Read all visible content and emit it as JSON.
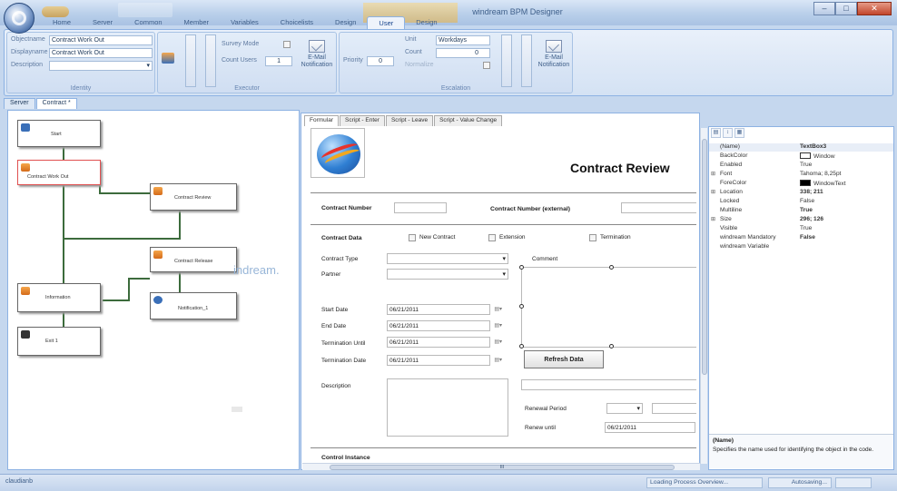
{
  "window": {
    "title": "windream BPM Designer"
  },
  "ribbon_tabs": [
    "Home",
    "Server",
    "Common",
    "Member",
    "Variables",
    "Choicelists",
    "Design",
    "User",
    "Design"
  ],
  "ribbon_active_tab": "User",
  "identity": {
    "objectname_label": "Objectname",
    "objectname_value": "Contract Work Out",
    "displayname_label": "Displayname",
    "displayname_value": "Contract Work Out",
    "description_label": "Description",
    "caption": "Identity"
  },
  "executor": {
    "survey_mode_label": "Survey Mode",
    "count_users_label": "Count Users",
    "count_users_value": "1",
    "email_label_1": "E-Mail",
    "email_label_2": "Notification",
    "caption": "Executor"
  },
  "escalation": {
    "priority_label": "Priority",
    "priority_value": "0",
    "unit_label": "Unit",
    "unit_value": "Workdays",
    "count_label": "Count",
    "count_value": "0",
    "normalize_label": "Normalize",
    "email_label_1": "E-Mail",
    "email_label_2": "Notification",
    "caption": "Escalation"
  },
  "doc_tabs": [
    "Server",
    "Contract *"
  ],
  "workflow": {
    "nodes": [
      "Start",
      "Contract Work Out",
      "Contract Review",
      "Contract Release",
      "Information",
      "Notification_1",
      "Exit 1"
    ],
    "watermark": "indream."
  },
  "form_tabs": [
    "Formular",
    "Script - Enter",
    "Script - Leave",
    "Script - Value Change"
  ],
  "form": {
    "title": "Contract Review",
    "contract_number_label": "Contract Number",
    "contract_number_ext_label": "Contract Number (external)",
    "contract_data_label": "Contract Data",
    "new_contract_label": "New Contract",
    "extension_label": "Extension",
    "termination_label": "Termination",
    "contract_type_label": "Contract Type",
    "partner_label": "Partner",
    "comment_label": "Comment",
    "start_date_label": "Start Date",
    "start_date_value": "06/21/2011",
    "end_date_label": "End Date",
    "end_date_value": "06/21/2011",
    "termination_until_label": "Termination Until",
    "termination_until_value": "06/21/2011",
    "termination_date_label": "Termination Date",
    "termination_date_value": "06/21/2011",
    "refresh_label": "Refresh Data",
    "description_label": "Description",
    "renewal_period_label": "Renewal Period",
    "renew_until_label": "Renew until",
    "renew_until_value": "06/21/2011",
    "bottom_label": "Control Instance"
  },
  "scroll_label": "III",
  "properties": {
    "rows": [
      {
        "name": "(Name)",
        "value": "TextBox3",
        "bold": true
      },
      {
        "name": "BackColor",
        "value": "Window",
        "swatch": "#ffffff"
      },
      {
        "name": "Enabled",
        "value": "True"
      },
      {
        "name": "Font",
        "value": "Tahoma; 8,25pt",
        "expand": "⊞"
      },
      {
        "name": "ForeColor",
        "value": "WindowText",
        "swatch": "#000000"
      },
      {
        "name": "Location",
        "value": "338; 211",
        "bold": true,
        "expand": "⊞"
      },
      {
        "name": "Locked",
        "value": "False"
      },
      {
        "name": "Multiline",
        "value": "True",
        "bold": true
      },
      {
        "name": "Size",
        "value": "296; 126",
        "bold": true,
        "expand": "⊞"
      },
      {
        "name": "Visible",
        "value": "True"
      },
      {
        "name": "windream Mandatory",
        "value": "False",
        "bold": true
      },
      {
        "name": "windream Variable",
        "value": ""
      }
    ],
    "desc_title": "(Name)",
    "desc_text": "Specifies the name used for identifying the object in the code."
  },
  "status": {
    "user": "claudianb",
    "loading": "Loading Process Overview...",
    "autosave": "Autosaving..."
  }
}
